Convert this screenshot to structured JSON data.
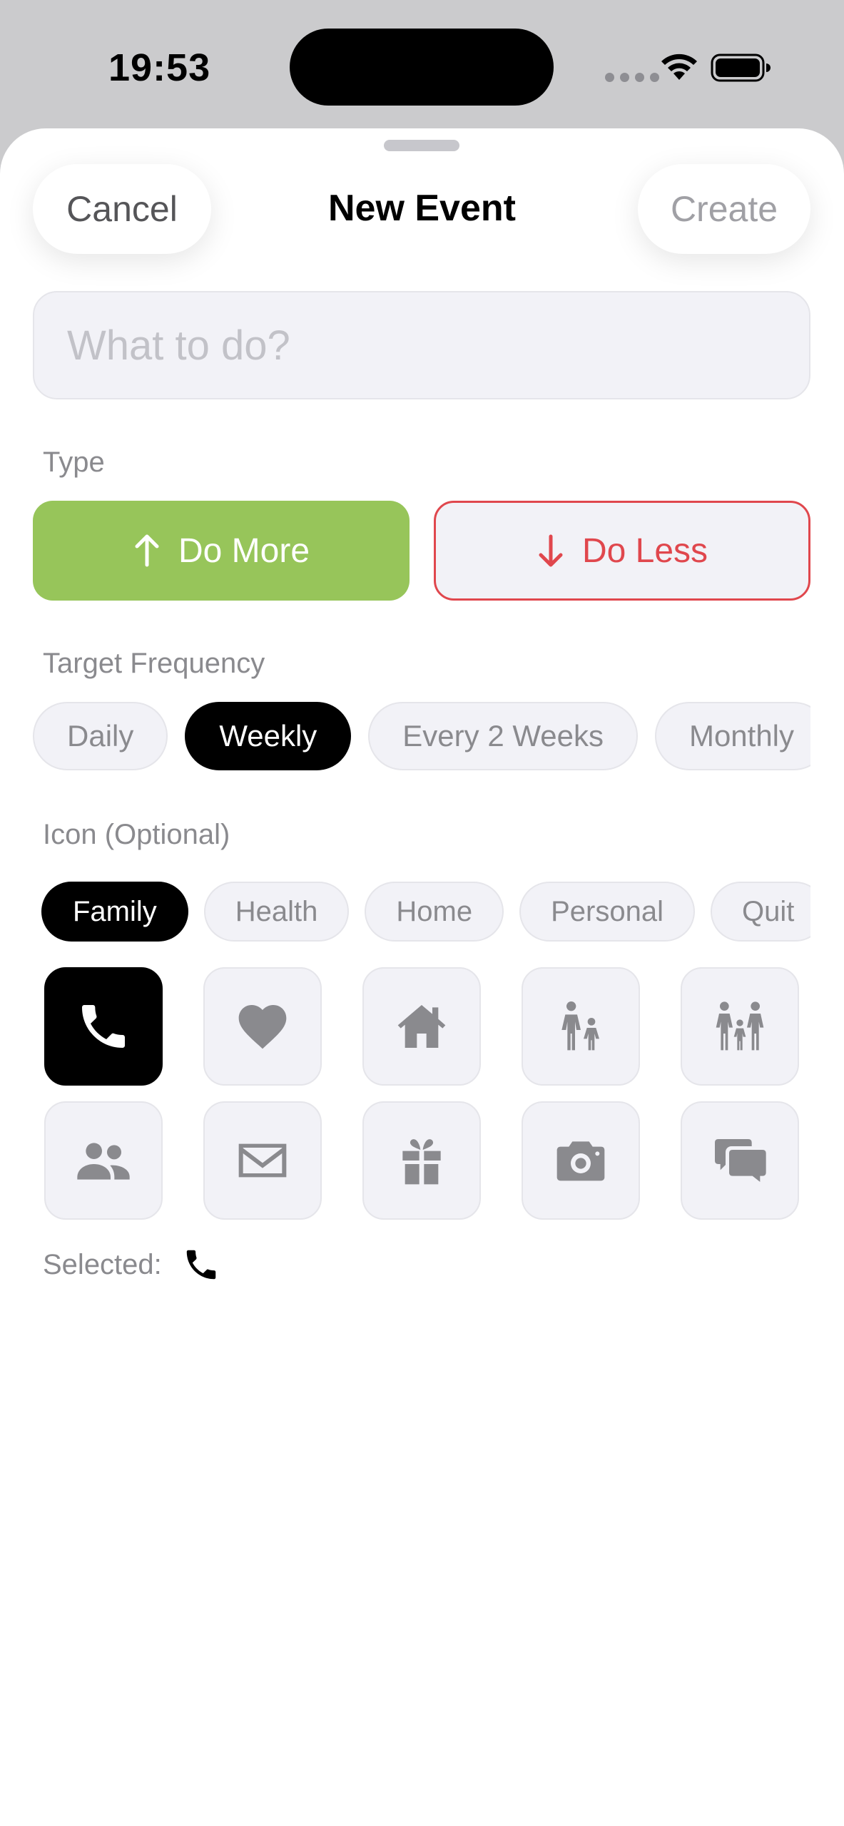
{
  "status_bar": {
    "time": "19:53"
  },
  "nav": {
    "cancel_label": "Cancel",
    "title": "New Event",
    "create_label": "Create"
  },
  "title_field": {
    "value": "",
    "placeholder": "What to do?"
  },
  "type_section": {
    "label": "Type",
    "options": [
      {
        "label": "Do More",
        "icon": "arrow-up-icon",
        "color": "#97c55a",
        "selected": true
      },
      {
        "label": "Do Less",
        "icon": "arrow-down-icon",
        "color": "#e0474d",
        "selected": false
      }
    ]
  },
  "frequency_section": {
    "label": "Target Frequency",
    "options": [
      "Daily",
      "Weekly",
      "Every 2 Weeks",
      "Monthly"
    ],
    "selected": "Weekly"
  },
  "icon_section": {
    "label": "Icon (Optional)",
    "categories": [
      "Family",
      "Health",
      "Home",
      "Personal",
      "Quit"
    ],
    "selected_category": "Family",
    "icons": [
      "phone-icon",
      "heart-icon",
      "house-icon",
      "parent-child-icon",
      "family-icon",
      "people-icon",
      "envelope-icon",
      "gift-icon",
      "camera-icon",
      "chat-bubbles-icon"
    ],
    "selected_icon": "phone-icon",
    "selected_label": "Selected:"
  },
  "colors": {
    "accent_green": "#97c55a",
    "accent_red": "#e0474d",
    "chip_bg": "#f2f2f7",
    "selected_bg": "#000000"
  }
}
